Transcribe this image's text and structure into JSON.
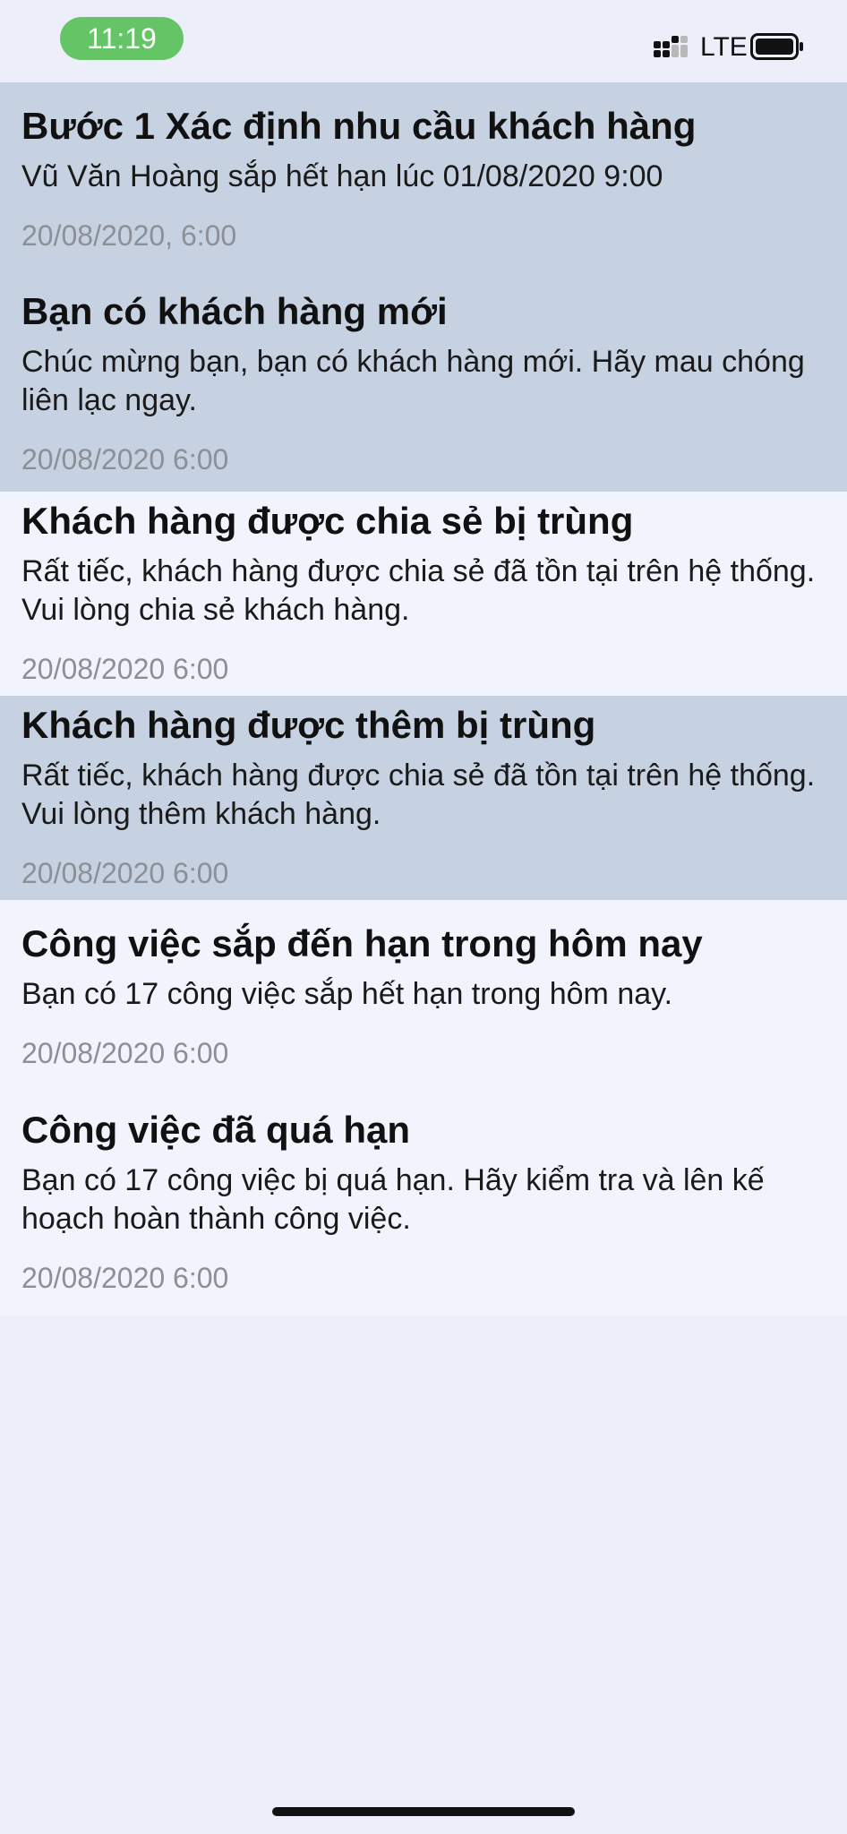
{
  "status_bar": {
    "time": "11:19",
    "network": "LTE",
    "icons": [
      "signal-icon",
      "battery-icon"
    ]
  },
  "notifications": [
    {
      "title": "Bước 1 Xác định nhu cầu khách hàng",
      "body": "Vũ Văn Hoàng sắp hết hạn lúc 01/08/2020 9:00",
      "time": "20/08/2020, 6:00",
      "unread": true
    },
    {
      "title": "Bạn có khách hàng mới",
      "body": "Chúc mừng bạn, bạn có khách hàng mới. Hãy mau chóng liên lạc ngay.",
      "time": "20/08/2020 6:00",
      "unread": true
    },
    {
      "title": "Khách hàng được chia sẻ bị trùng",
      "body": "Rất tiếc, khách hàng được chia sẻ đã tồn tại trên hệ thống. Vui lòng chia sẻ khách hàng.",
      "time": "20/08/2020 6:00",
      "unread": false
    },
    {
      "title": "Khách hàng được thêm bị trùng",
      "body": "Rất tiếc, khách hàng được chia sẻ đã tồn tại trên hệ thống. Vui lòng thêm khách hàng.",
      "time": "20/08/2020 6:00",
      "unread": true
    },
    {
      "title": "Công việc sắp đến hạn trong hôm nay",
      "body": "Bạn có 17 công việc sắp hết hạn trong hôm nay.",
      "time": "20/08/2020 6:00",
      "unread": false
    },
    {
      "title": "Công việc đã quá hạn",
      "body": "Bạn có 17 công việc bị quá hạn. Hãy kiểm tra và lên kế hoạch hoàn thành công việc.",
      "time": "20/08/2020 6:00",
      "unread": false
    }
  ],
  "colors": {
    "unread_bg": "#C6D2E1",
    "read_bg": "#F1F4FC",
    "screen_bg": "#ECEEFA",
    "time_pill": "#65C466",
    "timestamp": "#8D8F96"
  }
}
